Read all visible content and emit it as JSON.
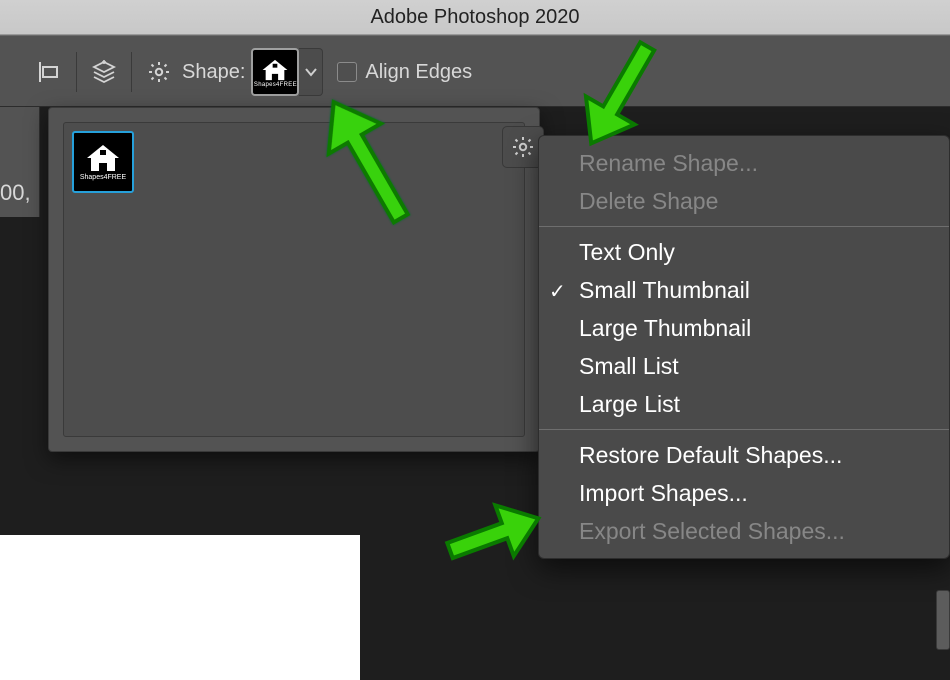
{
  "window": {
    "title": "Adobe Photoshop 2020"
  },
  "optionsBar": {
    "shape_label": "Shape:",
    "align_edges": "Align Edges",
    "swatch_caption": "Shapes4FREE"
  },
  "coord_readout": "00,",
  "shapePicker": {
    "selected_caption": "Shapes4FREE"
  },
  "ctx": {
    "rename": "Rename Shape...",
    "delete": "Delete Shape",
    "textOnly": "Text Only",
    "smallThumb": "Small Thumbnail",
    "largeThumb": "Large Thumbnail",
    "smallList": "Small List",
    "largeList": "Large List",
    "restore": "Restore Default Shapes...",
    "import": "Import Shapes...",
    "export": "Export Selected Shapes...",
    "checkmark": "✓",
    "view_selected": "smallThumb"
  }
}
